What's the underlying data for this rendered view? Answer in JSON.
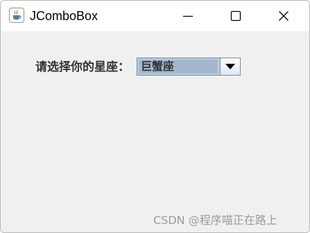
{
  "window": {
    "title": "JComboBox",
    "app_icon": "java-icon",
    "controls": {
      "minimize_icon": "minimize-icon",
      "maximize_icon": "maximize-icon",
      "close_icon": "close-icon"
    }
  },
  "form": {
    "label": "请选择你的星座：",
    "combo_selected": "巨蟹座",
    "combo_arrow_icon": "triangle-down-icon"
  },
  "watermark": "CSDN @程序喵正在路上",
  "colors": {
    "titlebar": "#ffffff",
    "content_bg": "#f0f0f0",
    "combo_selection": "#a3b8cc",
    "combo_border": "#7a8a99",
    "text": "#333333"
  }
}
